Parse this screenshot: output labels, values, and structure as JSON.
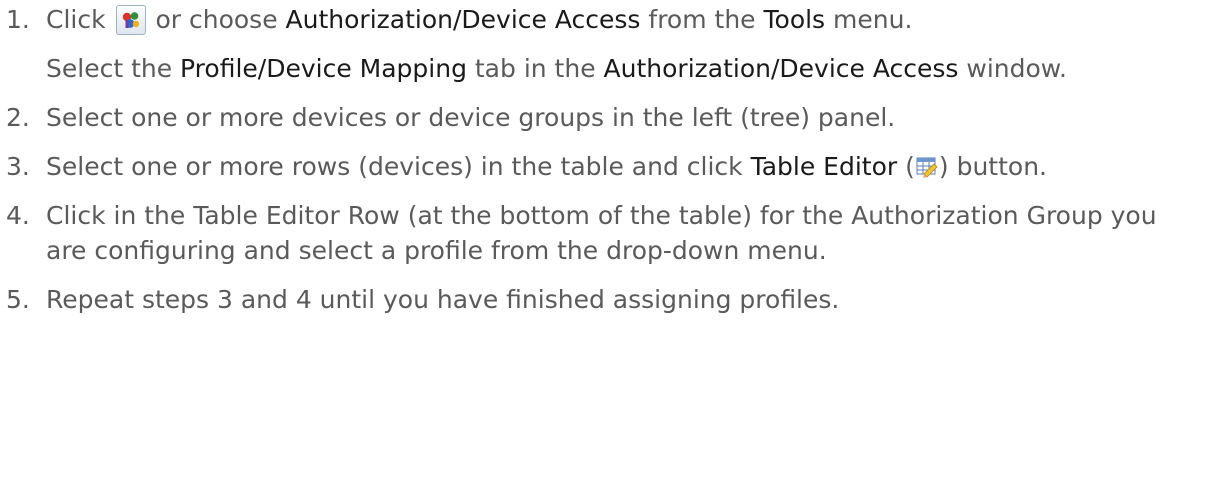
{
  "steps": [
    {
      "number": "1.",
      "parts": {
        "pre": "Click",
        "mid": " or choose ",
        "menu_item": "Authorization/Device Access",
        "mid2": " from the ",
        "menu": "Tools",
        "post": " menu."
      },
      "sub": {
        "pre": "Select the ",
        "tab": "Profile/Device Mapping",
        "mid": " tab in the ",
        "window": "Authorization/Device Access",
        "post": " window."
      },
      "icon": "authorization-icon"
    },
    {
      "number": "2.",
      "text": "Select one or more devices or device groups in the left (tree) panel."
    },
    {
      "number": "3.",
      "parts": {
        "pre": "Select one or more rows (devices) in the table and click ",
        "button": "Table Editor",
        "open": " (",
        "close": ")",
        "post": " button."
      },
      "icon": "table-editor-icon"
    },
    {
      "number": "4.",
      "text": "Click in the Table Editor Row (at the bottom of the table) for the Authorization Group you are configuring and select a profile from the drop-down menu."
    },
    {
      "number": "5.",
      "text": "Repeat steps 3 and 4 until you have finished assigning profiles."
    }
  ],
  "colors": {
    "body_text": "#5a5a5a",
    "ui_term": "#1a1a1a"
  }
}
